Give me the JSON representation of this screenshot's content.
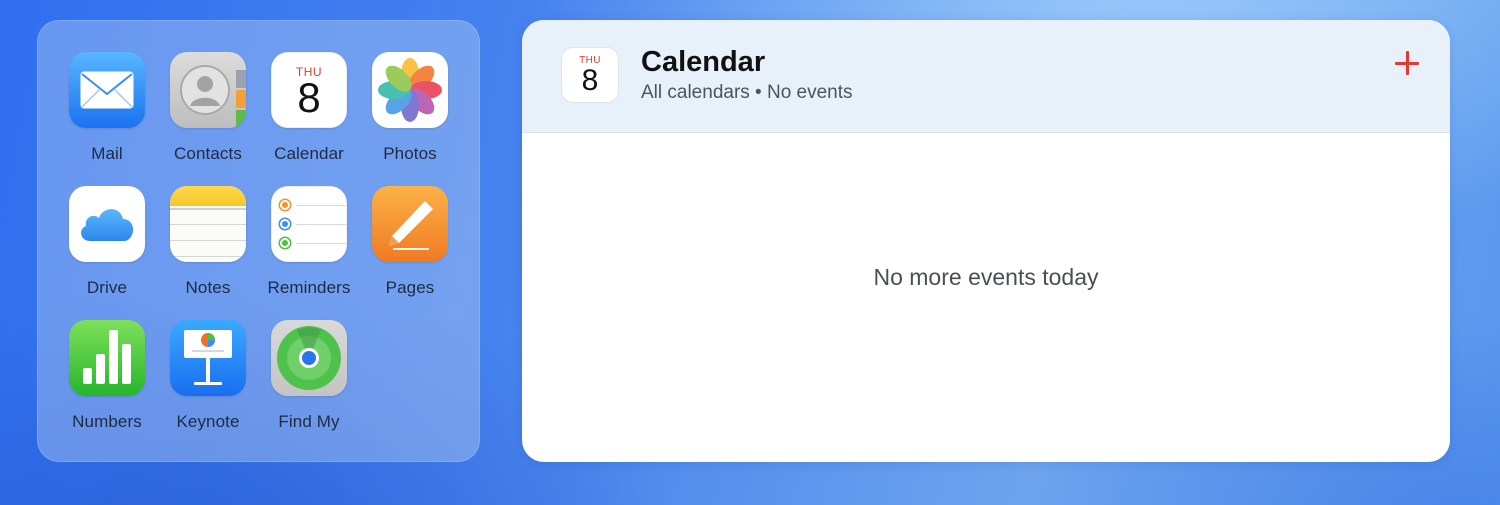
{
  "apps": [
    {
      "id": "mail",
      "label": "Mail",
      "icon": "mail-icon"
    },
    {
      "id": "contacts",
      "label": "Contacts",
      "icon": "contacts-icon"
    },
    {
      "id": "calendar",
      "label": "Calendar",
      "icon": "calendar-icon",
      "day": "THU",
      "date": "8"
    },
    {
      "id": "photos",
      "label": "Photos",
      "icon": "photos-icon"
    },
    {
      "id": "drive",
      "label": "Drive",
      "icon": "cloud-icon"
    },
    {
      "id": "notes",
      "label": "Notes",
      "icon": "notes-icon"
    },
    {
      "id": "reminders",
      "label": "Reminders",
      "icon": "reminders-icon"
    },
    {
      "id": "pages",
      "label": "Pages",
      "icon": "pages-icon"
    },
    {
      "id": "numbers",
      "label": "Numbers",
      "icon": "numbers-icon"
    },
    {
      "id": "keynote",
      "label": "Keynote",
      "icon": "keynote-icon"
    },
    {
      "id": "findmy",
      "label": "Find My",
      "icon": "findmy-icon"
    }
  ],
  "calendar_widget": {
    "badge_day": "THU",
    "badge_date": "8",
    "title": "Calendar",
    "subtitle": "All calendars • No events",
    "add_icon": "plus-icon",
    "empty_message": "No more events today",
    "accent_color": "#e8372c"
  }
}
